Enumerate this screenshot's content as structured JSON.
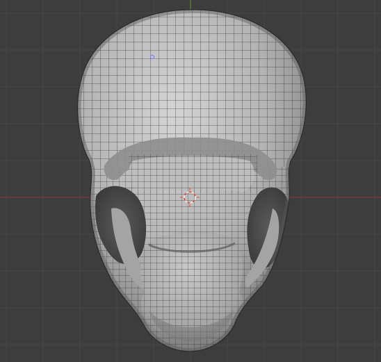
{
  "viewport": {
    "view": "3D Viewport",
    "object": "mesh",
    "display": "wireframe-overlay"
  },
  "colors": {
    "background": "#3d3d3d",
    "grid": "#474747",
    "axis_x": "#8a3a3a",
    "axis_y": "#5f8a2c",
    "mesh_light": "#c9c9c9",
    "mesh_mid": "#a8a8a8",
    "mesh_shadow": "#6a6a6a",
    "wire": "#2a2a2a",
    "cursor_red": "#e04a3a",
    "cursor_white": "#f0f0f0",
    "vertex_selected": "#8080ff"
  },
  "icons": {
    "cursor": "3d-cursor-icon",
    "origin": "object-origin-icon"
  }
}
